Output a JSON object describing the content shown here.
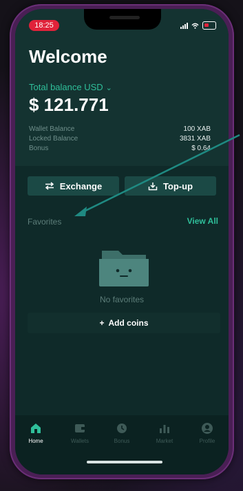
{
  "status_bar": {
    "time": "18:25"
  },
  "header": {
    "title": "Welcome",
    "total_label": "Total balance USD",
    "total_amount": "$ 121.771",
    "balances": [
      {
        "label": "Wallet Balance",
        "value": "100 XAB"
      },
      {
        "label": "Locked Balance",
        "value": "3831 XAB"
      },
      {
        "label": "Bonus",
        "value": "$ 0.64"
      }
    ]
  },
  "actions": {
    "exchange_label": "Exchange",
    "topup_label": "Top-up"
  },
  "favorites": {
    "title": "Favorites",
    "view_all": "View All",
    "empty_text": "No favorites",
    "add_coins_label": "Add coins"
  },
  "tabbar": {
    "tabs": [
      {
        "label": "Home",
        "icon": "home-icon",
        "active": true
      },
      {
        "label": "Wallets",
        "icon": "wallet-icon",
        "active": false
      },
      {
        "label": "Bonus",
        "icon": "bonus-icon",
        "active": false
      },
      {
        "label": "Market",
        "icon": "market-icon",
        "active": false
      },
      {
        "label": "Profile",
        "icon": "profile-icon",
        "active": false
      }
    ]
  },
  "colors": {
    "accent": "#2fbf9a",
    "background": "#0f2a29",
    "card": "#143331",
    "button": "#1b4945",
    "time_pill": "#e0223a",
    "annotation_arrow": "#1f8a82"
  }
}
